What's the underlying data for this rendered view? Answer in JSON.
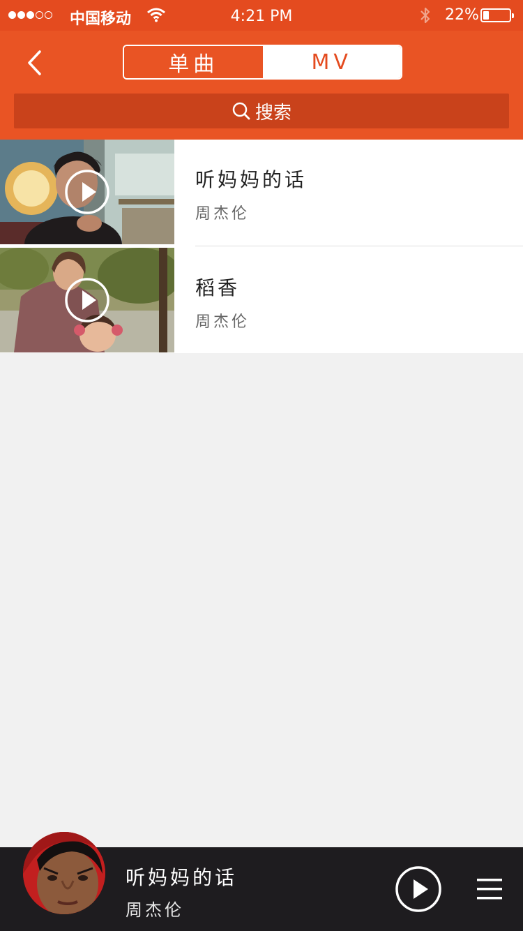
{
  "status_bar": {
    "carrier": "中国移动",
    "time": "4:21 PM",
    "battery_percent": "22%",
    "battery_level": 0.22,
    "signal_bars_filled": 3,
    "signal_bars_total": 5
  },
  "header": {
    "back_icon": "chevron-left-icon",
    "tabs": [
      {
        "label": "单曲",
        "active": true
      },
      {
        "label": "MV",
        "active": false
      }
    ],
    "search_label": "搜索",
    "colors": {
      "status_bar": "#e44b1f",
      "header": "#e95424",
      "search_bar": "#c9421b"
    }
  },
  "mv_list": [
    {
      "title": "听妈妈的话",
      "artist": "周杰伦"
    },
    {
      "title": "稻香",
      "artist": "周杰伦"
    }
  ],
  "now_playing": {
    "title": "听妈妈的话",
    "artist": "周杰伦",
    "play_icon": "play-icon",
    "menu_icon": "playlist-icon"
  }
}
